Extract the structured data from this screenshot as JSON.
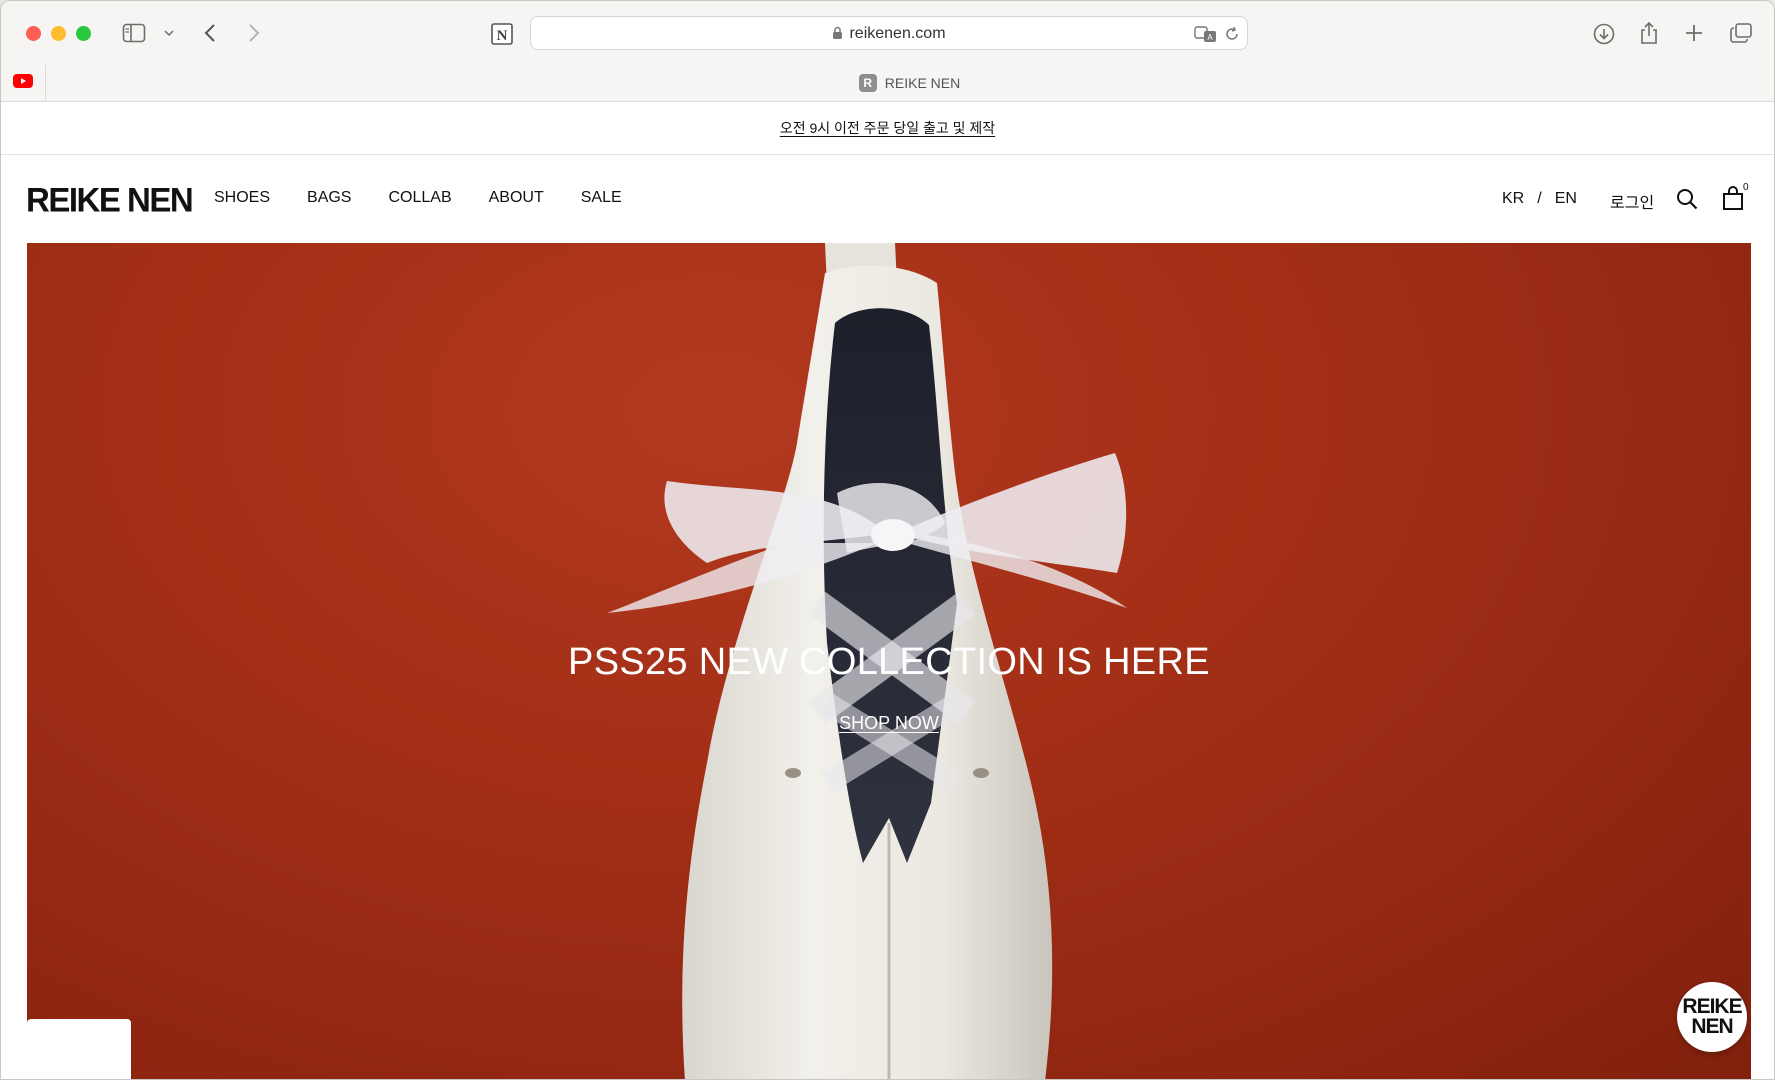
{
  "browser": {
    "url": "reikenen.com",
    "tab_title": "REIKE NEN",
    "tab_favicon_letter": "R",
    "pinned_tab_icon": "youtube-icon"
  },
  "announcement": {
    "text": "오전 9시 이전 주문 당일 출고 및 제작"
  },
  "header": {
    "logo": "REIKE NEN",
    "nav": [
      "SHOES",
      "BAGS",
      "COLLAB",
      "ABOUT",
      "SALE"
    ],
    "lang_kr": "KR",
    "lang_sep": "/",
    "lang_en": "EN",
    "login": "로그인",
    "cart_count": "0"
  },
  "hero": {
    "title": "PSS25 NEW COLLECTION IS HERE",
    "cta": "SHOP NOW",
    "background_color": "#a32f16"
  },
  "chat_badge": {
    "line1": "REIKE",
    "line2": "NEN"
  }
}
